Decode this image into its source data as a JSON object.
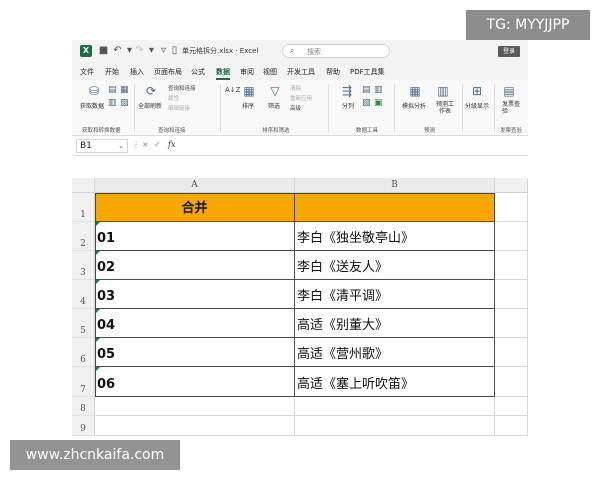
{
  "titlebar": {
    "app_icon": "X",
    "undo_icon": "undo-icon",
    "redo_icon": "redo-icon",
    "save_icon": "save-icon",
    "doc_title": "单元格拆分.xlsx · Excel",
    "search_placeholder": "搜索",
    "login_label": "登录"
  },
  "tabs": [
    "文件",
    "开始",
    "插入",
    "页面布局",
    "公式",
    "数据",
    "审阅",
    "视图",
    "开发工具",
    "帮助",
    "PDF工具集"
  ],
  "active_tab": "数据",
  "ribbon": {
    "get_data": "获取数据",
    "group_get": "获取和转换数据",
    "refresh_all": "全部刷新",
    "queries_connections": "查询和连接",
    "properties": "属性",
    "edit_links": "编辑链接",
    "group_queries": "查询和连接",
    "sort_az": "A↓Z",
    "sort": "排序",
    "filter": "筛选",
    "clear": "清除",
    "reapply": "重新应用",
    "advanced": "高级",
    "group_sort": "排序和筛选",
    "split": "分列",
    "group_tools": "数据工具",
    "what_if": "模拟分析",
    "forecast_sheet": "预测工作表",
    "group_forecast": "预测",
    "outline": "分级显示",
    "invoice_check": "发票查验",
    "group_invoice": "发票查验"
  },
  "formula_bar": {
    "name_box": "B1",
    "fx": "fx",
    "cancel_icon": "×",
    "enter_icon": "✓",
    "formula_value": ""
  },
  "grid": {
    "columns": [
      "A",
      "B"
    ],
    "rows": [
      "1",
      "2",
      "3",
      "4",
      "5",
      "6",
      "7",
      "8",
      "9"
    ],
    "header": {
      "a": "合并",
      "b": ""
    },
    "data": [
      {
        "a": "01",
        "b": "李白《独坐敬亭山》"
      },
      {
        "a": "02",
        "b": "李白《送友人》"
      },
      {
        "a": "03",
        "b": "李白《清平调》"
      },
      {
        "a": "04",
        "b": "高适《别董大》"
      },
      {
        "a": "05",
        "b": "高适《营州歌》"
      },
      {
        "a": "06",
        "b": "高适《塞上听吹笛》"
      }
    ],
    "header_color": "#f6a800",
    "error_marker_color": "#0b8a3c"
  },
  "watermarks": {
    "top": "TG: MYYJJPP",
    "bottom": "www.zhcnkaifa.com"
  }
}
